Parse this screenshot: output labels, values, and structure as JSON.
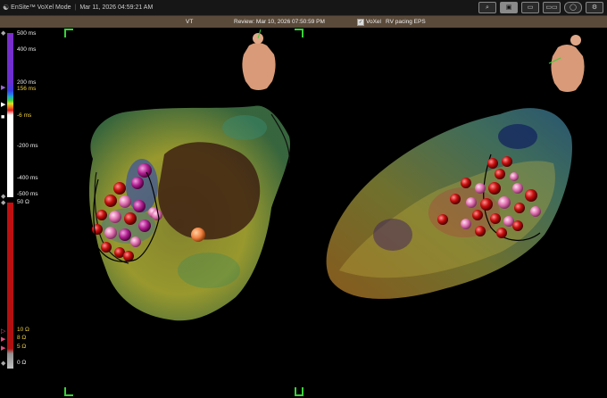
{
  "titlebar": {
    "app_name": "EnSite™ VoXel Mode",
    "timestamp": "Mar 11, 2026 04:59:21 AM",
    "buttons": [
      "zoom-icon",
      "capture-icon",
      "layout-single-icon",
      "layout-dual-icon",
      "layout-round-icon",
      "settings-icon"
    ]
  },
  "infobar": {
    "view": "VT",
    "review": "Review: Mar 10, 2026 07:50:59 PM",
    "voxel_label": "VoXel",
    "voxel_checked": true,
    "study": "RV pacing EPS"
  },
  "lat_scale": {
    "labels": [
      {
        "text": "500 ms",
        "color": "white"
      },
      {
        "text": "400 ms",
        "color": "white"
      },
      {
        "text": "200 ms",
        "color": "white"
      },
      {
        "text": "156 ms",
        "color": "yellow"
      },
      {
        "text": "-6 ms",
        "color": "yellow"
      },
      {
        "text": "-200 ms",
        "color": "white"
      },
      {
        "text": "-400 ms",
        "color": "white"
      },
      {
        "text": "-500 ms",
        "color": "white"
      }
    ]
  },
  "voltage_scale": {
    "labels": [
      {
        "text": "50 Ω",
        "color": "white"
      },
      {
        "text": "10 Ω",
        "color": "yellow"
      },
      {
        "text": "8 Ω",
        "color": "yellow"
      },
      {
        "text": "5 Ω",
        "color": "yellow"
      },
      {
        "text": "0 Ω",
        "color": "white"
      }
    ]
  },
  "colors": {
    "titlebar_bg": "#161616",
    "infobar_bg": "#5a4a3a",
    "corner_marker": "#3ad03a",
    "lesion_red": "#c81010",
    "lesion_pink": "#e070b0",
    "lesion_magenta": "#b02090"
  }
}
